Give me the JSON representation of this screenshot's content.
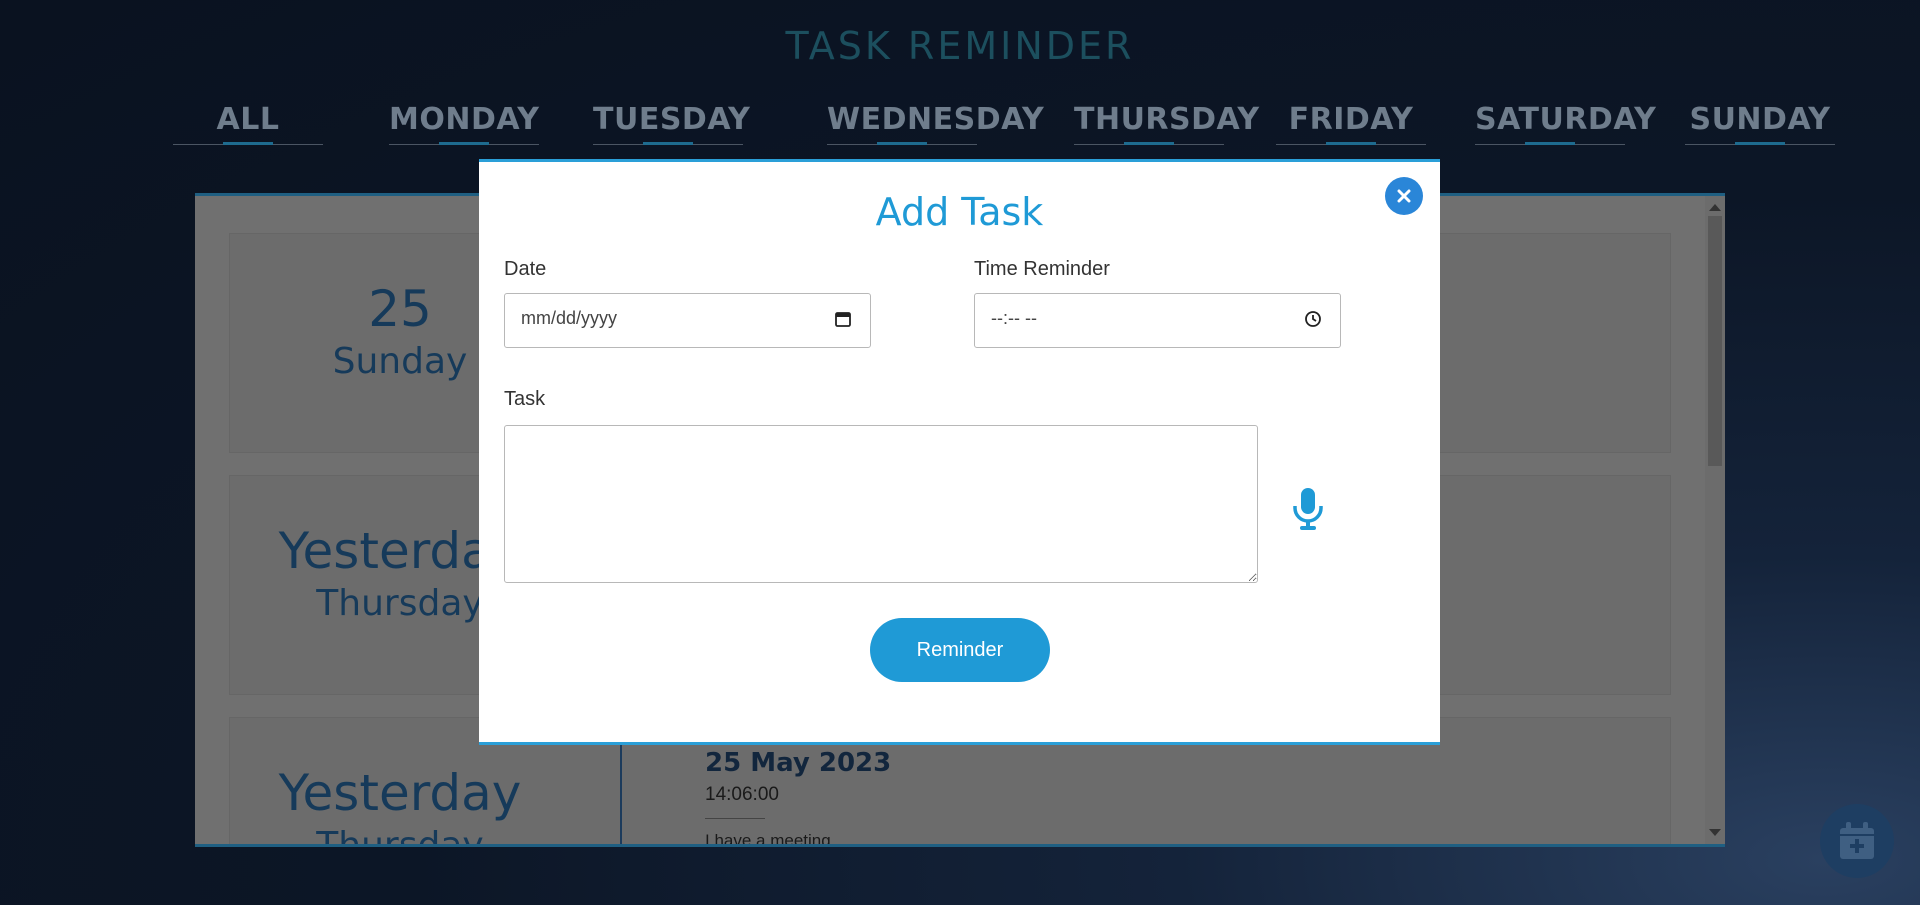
{
  "app": {
    "title": "TASK REMINDER"
  },
  "tabs": [
    {
      "label": "ALL"
    },
    {
      "label": "MONDAY"
    },
    {
      "label": "TUESDAY"
    },
    {
      "label": "WEDNESDAY"
    },
    {
      "label": "THURSDAY"
    },
    {
      "label": "FRIDAY"
    },
    {
      "label": "SATURDAY"
    },
    {
      "label": "SUNDAY"
    }
  ],
  "entries": [
    {
      "date_big": "25",
      "date_small": "Sunday"
    },
    {
      "date_big": "Yesterday",
      "date_small": "Thursday"
    },
    {
      "date_big": "Yesterday",
      "date_small": "Thursday",
      "title": "25 May 2023",
      "time": "14:06:00",
      "text": "I have a meeting"
    }
  ],
  "modal": {
    "title": "Add Task",
    "date_label": "Date",
    "date_placeholder": "mm/dd/yyyy",
    "time_label": "Time Reminder",
    "time_placeholder": "--:-- --",
    "task_label": "Task",
    "task_value": "",
    "submit_label": "Reminder"
  },
  "icons": {
    "close": "close-icon",
    "calendar": "calendar-icon",
    "clock": "clock-icon",
    "mic": "microphone-icon",
    "add_event": "calendar-plus-icon"
  },
  "colors": {
    "accent": "#1f9ad6",
    "close_button": "#2a86d8",
    "entry_text": "#163a5a",
    "fab": "#1e3e62"
  }
}
